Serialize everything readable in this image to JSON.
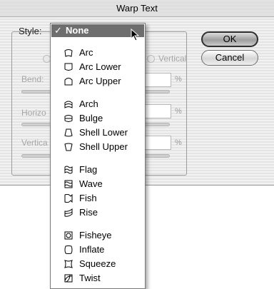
{
  "window": {
    "title": "Warp Text"
  },
  "style": {
    "label": "Style:"
  },
  "background": {
    "orientation_partial": "Vertical",
    "bend_label": "Bend:",
    "horizontal_partial": "Horizo",
    "vertical_partial": "Vertica",
    "percent": "%"
  },
  "buttons": {
    "ok": "OK",
    "cancel": "Cancel"
  },
  "menu": {
    "selected": {
      "check": "✓",
      "label": "None"
    },
    "groups": [
      {
        "items": [
          {
            "label": "Arc",
            "icon": "arc-icon"
          },
          {
            "label": "Arc Lower",
            "icon": "arc-lower-icon"
          },
          {
            "label": "Arc Upper",
            "icon": "arc-upper-icon"
          }
        ]
      },
      {
        "items": [
          {
            "label": "Arch",
            "icon": "arch-icon"
          },
          {
            "label": "Bulge",
            "icon": "bulge-icon"
          },
          {
            "label": "Shell Lower",
            "icon": "shell-lower-icon"
          },
          {
            "label": "Shell Upper",
            "icon": "shell-upper-icon"
          }
        ]
      },
      {
        "items": [
          {
            "label": "Flag",
            "icon": "flag-icon"
          },
          {
            "label": "Wave",
            "icon": "wave-icon"
          },
          {
            "label": "Fish",
            "icon": "fish-icon"
          },
          {
            "label": "Rise",
            "icon": "rise-icon"
          }
        ]
      },
      {
        "items": [
          {
            "label": "Fisheye",
            "icon": "fisheye-icon"
          },
          {
            "label": "Inflate",
            "icon": "inflate-icon"
          },
          {
            "label": "Squeeze",
            "icon": "squeeze-icon"
          },
          {
            "label": "Twist",
            "icon": "twist-icon"
          }
        ]
      }
    ]
  }
}
